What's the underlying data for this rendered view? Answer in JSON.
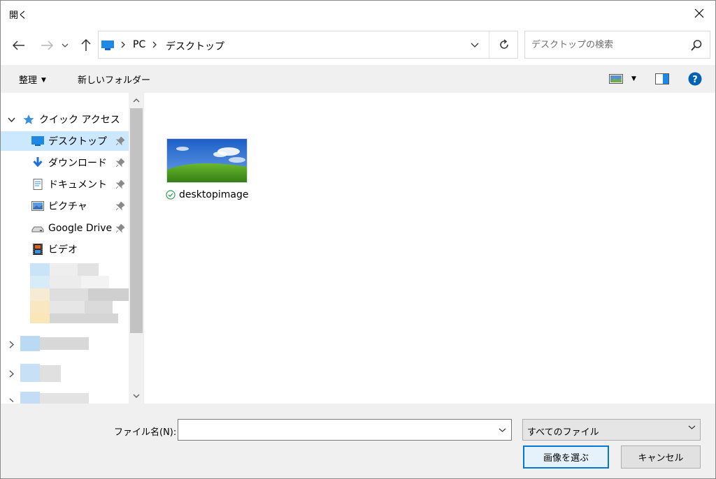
{
  "window": {
    "title": "開く"
  },
  "navigation": {
    "breadcrumb": [
      "PC",
      "デスクトップ"
    ],
    "search_placeholder": "デスクトップの検索"
  },
  "toolbar": {
    "organize_label": "整理",
    "new_folder_label": "新しいフォルダー"
  },
  "sidebar": {
    "quick_access_label": "クイック アクセス",
    "items": [
      {
        "label": "デスクトップ",
        "icon": "desktop-icon",
        "pinned": true,
        "selected": true
      },
      {
        "label": "ダウンロード",
        "icon": "download-icon",
        "pinned": true,
        "selected": false
      },
      {
        "label": "ドキュメント",
        "icon": "document-icon",
        "pinned": true,
        "selected": false
      },
      {
        "label": "ピクチャ",
        "icon": "pictures-icon",
        "pinned": true,
        "selected": false
      },
      {
        "label": "Google Drive",
        "icon": "drive-icon",
        "pinned": true,
        "selected": false
      },
      {
        "label": "ビデオ",
        "icon": "video-icon",
        "pinned": false,
        "selected": false
      }
    ]
  },
  "content": {
    "files": [
      {
        "name": "desktopimage",
        "status": "synced-check-icon"
      }
    ]
  },
  "footer": {
    "filename_label": "ファイル名(N):",
    "filename_value": "",
    "filetype_selected": "すべてのファイル",
    "open_button": "画像を選ぶ",
    "cancel_button": "キャンセル"
  },
  "colors": {
    "selection": "#cce8ff",
    "accent": "#0078d7",
    "help": "#0063b1"
  }
}
